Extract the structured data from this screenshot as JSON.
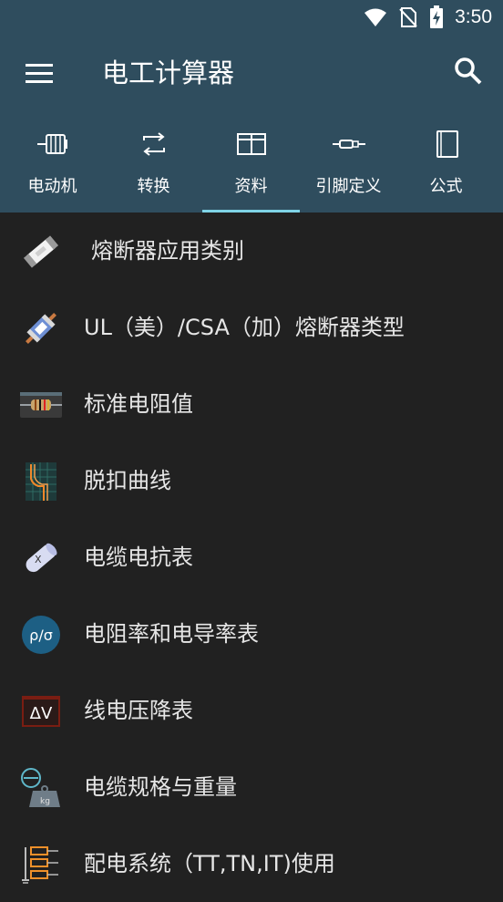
{
  "status_bar": {
    "time": "3:50",
    "icons": [
      "wifi-icon",
      "no-sim-icon",
      "battery-charging-icon"
    ]
  },
  "app_bar": {
    "title": "电工计算器",
    "menu_icon": "hamburger-menu-icon",
    "search_icon": "search-icon",
    "background_color": "#2f4d5e"
  },
  "tabs": [
    {
      "label": "电动机",
      "icon": "motor-icon"
    },
    {
      "label": "转换",
      "icon": "convert-icon"
    },
    {
      "label": "资料",
      "icon": "table-icon",
      "active": true
    },
    {
      "label": "引脚定义",
      "icon": "connector-icon"
    },
    {
      "label": "公式",
      "icon": "book-icon"
    }
  ],
  "accent_color": "#7fd3e6",
  "list": [
    {
      "label": "熔断器应用类别",
      "icon": "fuse-icon"
    },
    {
      "label": "UL（美）/CSA（加）熔断器类型",
      "icon": "ul-fuse-icon"
    },
    {
      "label": "标准电阻值",
      "icon": "resistor-icon"
    },
    {
      "label": "脱扣曲线",
      "icon": "trip-curve-icon"
    },
    {
      "label": "电缆电抗表",
      "icon": "cable-reactance-icon"
    },
    {
      "label": "电阻率和电导率表",
      "icon": "resistivity-icon"
    },
    {
      "label": "线电压降表",
      "icon": "voltage-drop-icon"
    },
    {
      "label": "电缆规格与重量",
      "icon": "cable-weight-icon"
    },
    {
      "label": "配电系统（TT,TN,IT)使用",
      "icon": "distribution-system-icon"
    }
  ]
}
